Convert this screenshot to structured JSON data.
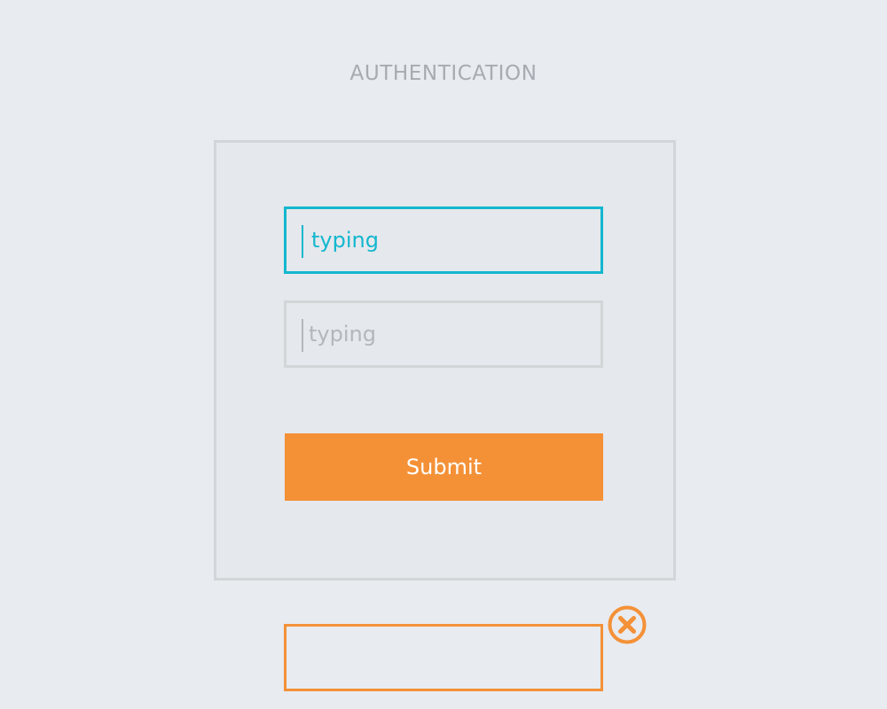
{
  "header": {
    "title": "AUTHENTICATION"
  },
  "form": {
    "field1": {
      "value": "typing",
      "state": "focused"
    },
    "field2": {
      "value": "typing",
      "state": "idle"
    },
    "submit_label": "Submit"
  },
  "error": {
    "icon": "close-circle-icon",
    "message": ""
  },
  "colors": {
    "background": "#e8ebef",
    "focus": "#13b7cf",
    "accent": "#f49137",
    "border": "#d3d6d9",
    "muted_text": "#a7abb1"
  }
}
